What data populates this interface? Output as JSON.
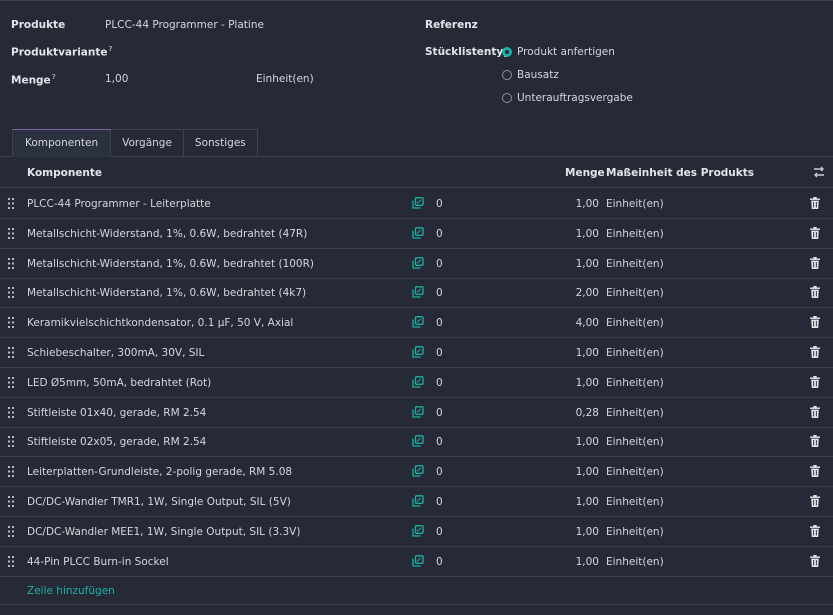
{
  "header": {
    "product_label": "Produkte",
    "product_value": "PLCC-44 Programmer - Platine",
    "variant_label": "Produktvariante",
    "variant_hint": "?",
    "qty_label": "Menge",
    "qty_hint": "?",
    "qty_value": "1,00",
    "qty_unit": "Einheit(en)",
    "reference_label": "Referenz",
    "bom_type_label": "Stücklistentyp",
    "bom_types": [
      {
        "label": "Produkt anfertigen",
        "selected": true
      },
      {
        "label": "Bausatz",
        "selected": false
      },
      {
        "label": "Unterauftragsvergabe",
        "selected": false
      }
    ]
  },
  "tabs": [
    {
      "label": "Komponenten",
      "active": true
    },
    {
      "label": "Vorgänge",
      "active": false
    },
    {
      "label": "Sonstiges",
      "active": false
    }
  ],
  "table": {
    "columns": {
      "component": "Komponente",
      "quantity": "Menge",
      "uom": "Maßeinheit des Produkts"
    },
    "rows": [
      {
        "name": "PLCC-44 Programmer - Leiterplatte",
        "on_hand": "0",
        "qty": "1,00",
        "unit": "Einheit(en)"
      },
      {
        "name": "Metallschicht-Widerstand, 1%, 0.6W, bedrahtet (47R)",
        "on_hand": "0",
        "qty": "1,00",
        "unit": "Einheit(en)"
      },
      {
        "name": "Metallschicht-Widerstand, 1%, 0.6W, bedrahtet (100R)",
        "on_hand": "0",
        "qty": "1,00",
        "unit": "Einheit(en)"
      },
      {
        "name": "Metallschicht-Widerstand, 1%, 0.6W, bedrahtet (4k7)",
        "on_hand": "0",
        "qty": "2,00",
        "unit": "Einheit(en)"
      },
      {
        "name": "Keramikvielschichtkondensator, 0.1 µF, 50 V, Axial",
        "on_hand": "0",
        "qty": "4,00",
        "unit": "Einheit(en)"
      },
      {
        "name": "Schiebeschalter, 300mA, 30V, SIL",
        "on_hand": "0",
        "qty": "1,00",
        "unit": "Einheit(en)"
      },
      {
        "name": "LED Ø5mm, 50mA, bedrahtet (Rot)",
        "on_hand": "0",
        "qty": "1,00",
        "unit": "Einheit(en)"
      },
      {
        "name": "Stiftleiste 01x40, gerade, RM 2.54",
        "on_hand": "0",
        "qty": "0,28",
        "unit": "Einheit(en)"
      },
      {
        "name": "Stiftleiste 02x05, gerade, RM 2.54",
        "on_hand": "0",
        "qty": "1,00",
        "unit": "Einheit(en)"
      },
      {
        "name": "Leiterplatten-Grundleiste, 2-polig gerade, RM 5.08",
        "on_hand": "0",
        "qty": "1,00",
        "unit": "Einheit(en)"
      },
      {
        "name": "DC/DC-Wandler TMR1, 1W, Single Output, SIL (5V)",
        "on_hand": "0",
        "qty": "1,00",
        "unit": "Einheit(en)"
      },
      {
        "name": "DC/DC-Wandler MEE1, 1W, Single Output, SIL (3.3V)",
        "on_hand": "0",
        "qty": "1,00",
        "unit": "Einheit(en)"
      },
      {
        "name": "44-Pin PLCC Burn-in Sockel",
        "on_hand": "0",
        "qty": "1,00",
        "unit": "Einheit(en)"
      }
    ],
    "add_line": "Zeile hinzufügen"
  },
  "icons": {
    "drag_handle": "drag-handle-icon",
    "forecast": "forecast-report-icon",
    "trash": "trash-icon",
    "column_settings": "column-settings-icon"
  },
  "colors": {
    "accent": "#1cb0a3",
    "tab_active_border": "#7a5ea8",
    "background": "#262a36"
  }
}
